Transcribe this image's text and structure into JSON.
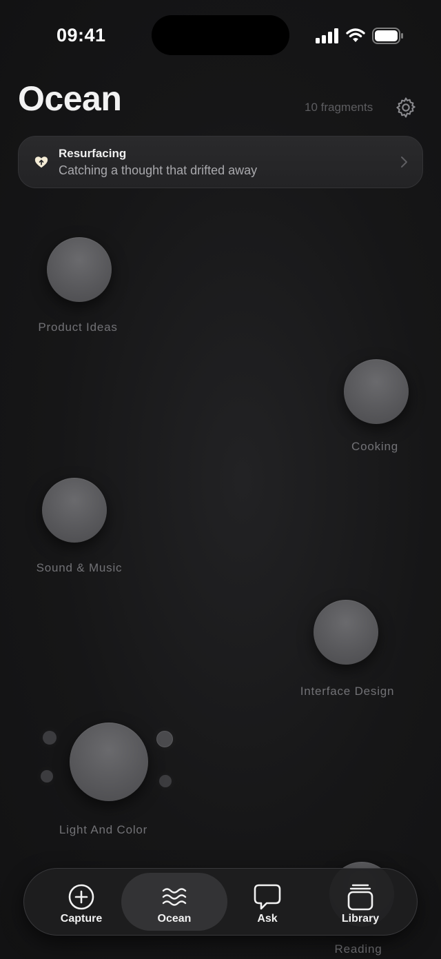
{
  "status_bar": {
    "time": "09:41"
  },
  "header": {
    "title": "Ocean",
    "fragment_count": "10 fragments",
    "settings_icon": "gear-icon"
  },
  "resurfacing": {
    "title": "Resurfacing",
    "subtitle": "Catching a thought that drifted away",
    "icon": "heart-icon",
    "accent": "#f4ecd6"
  },
  "topics": [
    {
      "label": "Product Ideas"
    },
    {
      "label": "Cooking"
    },
    {
      "label": "Sound & Music"
    },
    {
      "label": "Interface Design"
    },
    {
      "label": "Light And Color"
    },
    {
      "label": "Reading"
    }
  ],
  "tab_bar": {
    "tabs": [
      {
        "label": "Capture",
        "icon": "plus-circle-icon"
      },
      {
        "label": "Ocean",
        "icon": "waves-icon",
        "active": true
      },
      {
        "label": "Ask",
        "icon": "chat-bubble-icon"
      },
      {
        "label": "Library",
        "icon": "stack-icon"
      }
    ]
  },
  "colors": {
    "background": "#161617",
    "orb": "#5a5a5d",
    "label": "#727276"
  }
}
